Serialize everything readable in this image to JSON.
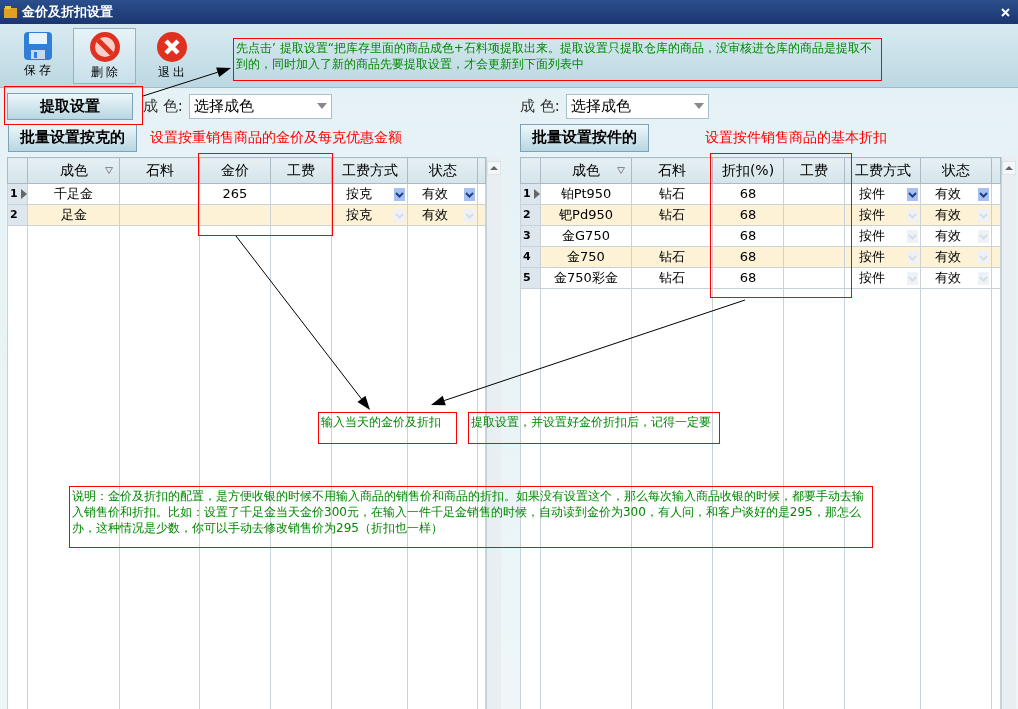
{
  "window": {
    "title": "金价及折扣设置"
  },
  "toolbar": [
    {
      "label": "保 存",
      "kind": "save",
      "selected": false
    },
    {
      "label": "删 除",
      "kind": "delete",
      "selected": true
    },
    {
      "label": "退 出",
      "kind": "exit",
      "selected": false
    }
  ],
  "panels": [
    {
      "extract_button": "提取设置",
      "color_label": "成 色:",
      "color_select": "选择成色",
      "batch_button": "批量设置按克的",
      "hint": "设置按重销售商品的金价及每克优惠金额",
      "table": {
        "columns": [
          {
            "label": "成色",
            "kind": "filter"
          },
          {
            "label": "石料",
            "kind": "text"
          },
          {
            "label": "金价",
            "kind": "text"
          },
          {
            "label": "工费",
            "kind": "text"
          },
          {
            "label": "工费方式",
            "kind": "dropdown"
          },
          {
            "label": "状态",
            "kind": "dropdown"
          }
        ],
        "rows": [
          {
            "number": "1",
            "selected": true,
            "cells": [
              "千足金",
              null,
              "265",
              null,
              "按克",
              "有效"
            ]
          },
          {
            "number": "2",
            "selected": false,
            "cells": [
              "足金",
              null,
              null,
              null,
              "按克",
              "有效"
            ]
          }
        ]
      }
    },
    {
      "color_label": "成 色:",
      "color_select": "选择成色",
      "batch_button": "批量设置按件的",
      "hint": "设置按件销售商品的基本折扣",
      "table": {
        "columns": [
          {
            "label": "成色",
            "kind": "filter"
          },
          {
            "label": "石料",
            "kind": "text"
          },
          {
            "label": "折扣(%)",
            "kind": "text"
          },
          {
            "label": "工费",
            "kind": "text"
          },
          {
            "label": "工费方式",
            "kind": "dropdown"
          },
          {
            "label": "状态",
            "kind": "dropdown"
          }
        ],
        "rows": [
          {
            "number": "1",
            "selected": true,
            "cells": [
              "铂Pt950",
              "钻石",
              "68",
              null,
              "按件",
              "有效"
            ]
          },
          {
            "number": "2",
            "selected": false,
            "cells": [
              "钯Pd950",
              "钻石",
              "68",
              null,
              "按件",
              "有效"
            ]
          },
          {
            "number": "3",
            "selected": false,
            "cells": [
              "金G750",
              null,
              "68",
              null,
              "按件",
              "有效"
            ]
          },
          {
            "number": "4",
            "selected": false,
            "cells": [
              "金750",
              "钻石",
              "68",
              null,
              "按件",
              "有效"
            ]
          },
          {
            "number": "5",
            "selected": false,
            "cells": [
              "金750彩金",
              "钻石",
              "68",
              null,
              "按件",
              "有效"
            ]
          }
        ]
      }
    }
  ],
  "notes": [
    {
      "text": "先点击’ 提取设置“把库存里面的商品成色+石料项提取出来。提取设置只提取仓库的商品，没审核进仓库的商品是提取不到的，同时加入了新的商品先要提取设置，才会更新到下面列表中"
    },
    {
      "text": "输入当天的金价及折扣"
    },
    {
      "text": "提取设置，并设置好金价折扣后，记得一定要"
    },
    {
      "text": "说明：金价及折扣的配置，是方便收银的时候不用输入商品的销售价和商品的折扣。如果没有设置这个，那么每次输入商品收银的时候，都要手动去输入销售价和折扣。比如：设置了千足金当天金价300元，在输入一件千足金销售的时候，自动读到金价为300，有人问，和客户谈好的是295，那怎么办，这种情况是少数，你可以手动去修改销售价为295（折扣也一样）"
    }
  ]
}
